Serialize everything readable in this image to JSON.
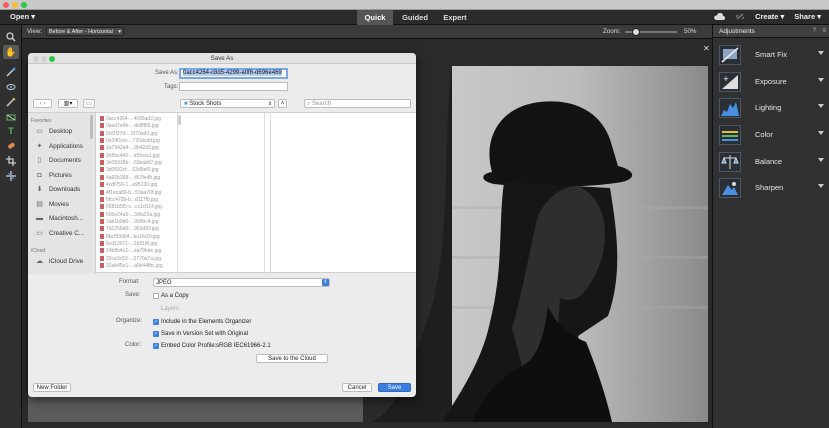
{
  "menubar": {
    "open_label": "Open",
    "modes": [
      "Quick",
      "Guided",
      "Expert"
    ],
    "create_label": "Create",
    "share_label": "Share"
  },
  "optionsbar": {
    "view_label": "View:",
    "view_value": "Before & After - Horizontal",
    "zoom_label": "Zoom:",
    "zoom_value": "50%",
    "zoom_fraction": 0.5
  },
  "adjustments": {
    "title": "Adjustments",
    "items": [
      "Smart Fix",
      "Exposure",
      "Lighting",
      "Color",
      "Balance",
      "Sharpen"
    ]
  },
  "dialog": {
    "title": "Save As",
    "saveas_label": "Save As:",
    "saveas_value": "0acc4264-c8d5-4299-a0f6-d696e469",
    "tags_label": "Tags:",
    "location": "Stock Shots",
    "search_placeholder": "Search",
    "favorites_label": "Favorites",
    "favorites": [
      "Desktop",
      "Applications",
      "Documents",
      "Pictures",
      "Downloads",
      "Movies",
      "Macintosh...",
      "Creative C..."
    ],
    "icloud_label": "iCloud",
    "icloud_items": [
      "iCloud Drive"
    ],
    "files": [
      "0acc4264-...4695ad2.jpg",
      "0aad7e4b-...dc8f8f6.jpg",
      "0cf2f27d-...5f70ad3.jpg",
      "0e29f1eb-...720dcdd.jpg",
      "2a7942a4-...9b42d2.jpg",
      "2e5bc449-...ef3cea1.jpg",
      "3e05918b-...69eab67.jpg",
      "3d0692cf-...63d5ef0.jpg",
      "4a92b368-...457fe4b.jpg",
      "4cdf759-1...e95130.jpg",
      "4f1eca80-b...53aa70f.jpg",
      "6fcc472b-b...d117fb.jpg",
      "6581b5f5-c...cc1d114.jpg",
      "606e24a0-...3dfa22a.jpg",
      "7ab1b0d0-...906bc4.jpg",
      "7d1255d0-...963d83.jpg",
      "8bcf93d94...ba1fe20.jpg",
      "9cd12071-...2b318f.jpg",
      "14b8b4c2-...da79bee.jpg",
      "22ca3c53-...0770a7a.jpg",
      "32ab45e1-...a0e44fbc.jpg"
    ],
    "format_label": "Format:",
    "format_value": "JPEG",
    "save_label": "Save:",
    "as_copy_label": "As a Copy",
    "layers_label": "Layers",
    "organize_label": "Organize:",
    "include_organizer_label": "Include in the Elements Organizer",
    "version_set_label": "Save in Version Set with Original",
    "color_label": "Color:",
    "embed_profile_label": "Embed Color Profile:",
    "profile_value": "sRGB IEC61966-2.1",
    "save_cloud_label": "Save to the Cloud",
    "new_folder_label": "New Folder",
    "cancel_label": "Cancel",
    "save_button_label": "Save"
  }
}
